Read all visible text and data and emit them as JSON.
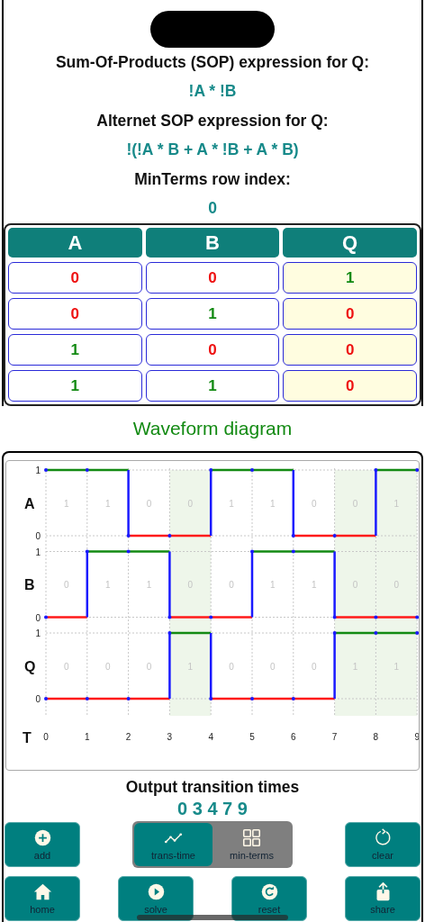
{
  "expressions": [
    {
      "kind": "label",
      "text": "Sum-Of-Products (SOP) expression for Q:"
    },
    {
      "kind": "value",
      "text": "!A * !B"
    },
    {
      "kind": "label",
      "text": "Alternet SOP expression for Q:"
    },
    {
      "kind": "value",
      "text": "!(!A * B + A * !B + A * B)"
    },
    {
      "kind": "label",
      "text": "MinTerms row index:"
    },
    {
      "kind": "value",
      "text": "0"
    }
  ],
  "truth_table": {
    "columns": [
      {
        "label": "A",
        "kind": "input"
      },
      {
        "label": "B",
        "kind": "input"
      },
      {
        "label": "Q",
        "kind": "output"
      }
    ],
    "rows": [
      [
        "0",
        "0",
        "1"
      ],
      [
        "0",
        "1",
        "0"
      ],
      [
        "1",
        "0",
        "0"
      ],
      [
        "1",
        "1",
        "0"
      ]
    ]
  },
  "waveform_title": "Waveform diagram",
  "waveform": {
    "signals": [
      {
        "name": "A",
        "kind": "input",
        "high_label": "1",
        "low_label": "0",
        "bits": [
          "1",
          "1",
          "0",
          "0",
          "1",
          "1",
          "0",
          "0",
          "1"
        ]
      },
      {
        "name": "B",
        "kind": "input",
        "high_label": "1",
        "low_label": "0",
        "bits": [
          "0",
          "1",
          "1",
          "0",
          "0",
          "1",
          "1",
          "0",
          "0"
        ]
      },
      {
        "name": "Q",
        "kind": "output",
        "high_label": "1",
        "low_label": "0",
        "bits": [
          "0",
          "0",
          "0",
          "1",
          "0",
          "0",
          "0",
          "1",
          "1"
        ]
      }
    ],
    "time_label": "T",
    "time_ticks": [
      "0",
      "1",
      "2",
      "3",
      "4",
      "5",
      "6",
      "7",
      "8",
      "9"
    ]
  },
  "output_title": "Output transition times",
  "output_value": "0 3 4 7 9",
  "toolbar": {
    "top_left": {
      "label": "add",
      "kind": "add"
    },
    "segments": [
      {
        "label": "trans-time",
        "kind": "line",
        "selected": true
      },
      {
        "label": "min-terms",
        "kind": "grid",
        "selected": false
      }
    ],
    "top_right": {
      "label": "clear",
      "kind": "clear"
    },
    "bottom": [
      {
        "label": "home",
        "kind": "home"
      },
      {
        "label": "solve",
        "kind": "play"
      },
      {
        "label": "reset",
        "kind": "reset"
      },
      {
        "label": "share",
        "kind": "share"
      }
    ]
  }
}
